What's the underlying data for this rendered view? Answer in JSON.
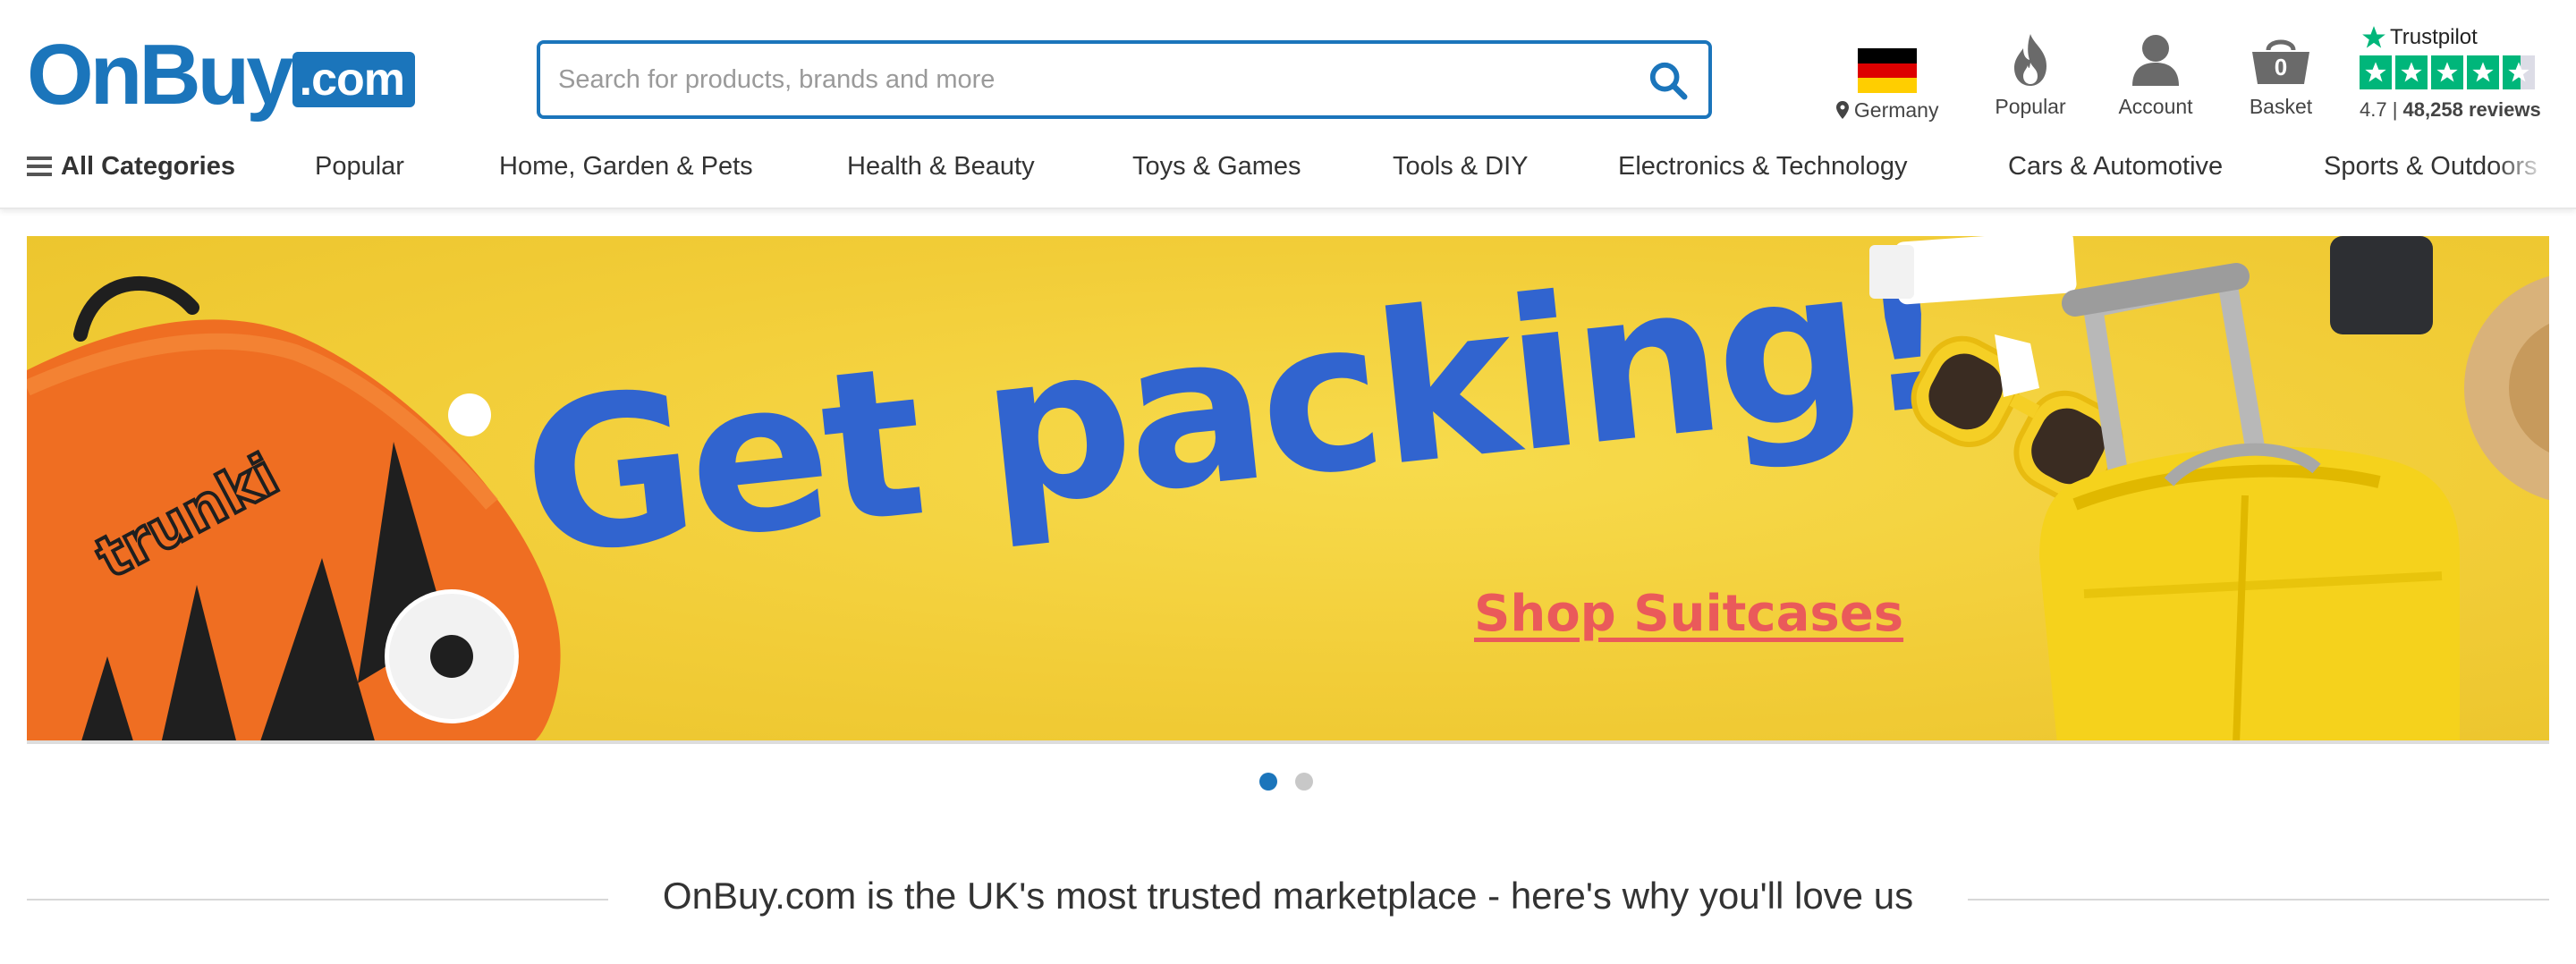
{
  "header": {
    "logo": {
      "main": "OnBuy",
      "suffix": ".com"
    },
    "search": {
      "placeholder": "Search for products, brands and more",
      "value": ""
    },
    "location": {
      "label": "Germany",
      "icon": "location-pin-icon",
      "flag": [
        "#000000",
        "#dd0000",
        "#ffce00"
      ]
    },
    "popular": {
      "label": "Popular",
      "icon": "flame-icon"
    },
    "account": {
      "label": "Account",
      "icon": "user-icon"
    },
    "basket": {
      "label": "Basket",
      "count": "0",
      "icon": "basket-icon"
    },
    "trustpilot": {
      "brand": "Trustpilot",
      "rating": "4.7",
      "reviews": "48,258 reviews",
      "stars": 4.5,
      "color": "#00b67a"
    }
  },
  "nav": {
    "all_categories": "All Categories",
    "items": [
      "Popular",
      "Home, Garden & Pets",
      "Health & Beauty",
      "Toys & Games",
      "Tools & DIY",
      "Electronics & Technology",
      "Cars & Automotive",
      "Sports & Outdoors"
    ]
  },
  "banner": {
    "headline": "Get packing!",
    "cta": "Shop Suitcases",
    "case_brand": "trunki",
    "background_color": "#f3d03a",
    "headline_color": "#3164cf",
    "cta_color": "#ea5a5a",
    "slides": 2,
    "active_slide": 1
  },
  "tagline": "OnBuy.com is the UK's most trusted marketplace - here's why you'll love us",
  "colors": {
    "brand": "#1b75bb",
    "text": "#333333"
  }
}
